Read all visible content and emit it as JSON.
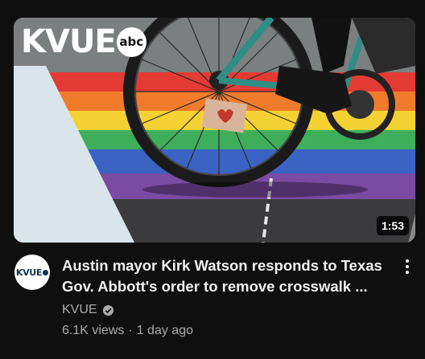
{
  "video": {
    "thumbnail": {
      "brand_text": "KVUE",
      "network_text": "abc",
      "duration": "1:53"
    },
    "channel_avatar_text": "KVUE",
    "title": "Austin mayor Kirk Watson responds to Texas Gov. Abbott's order to remove crosswalk ...",
    "channel": "KVUE",
    "views": "6.1K views",
    "separator": "·",
    "age": "1 day ago"
  },
  "icons": {
    "verified": "check-circle-icon",
    "more": "vertical-ellipsis-icon"
  },
  "colors": {
    "background": "#0f0f0f",
    "title": "#f1f1f1",
    "secondary_text": "#aaaaaa",
    "rainbow": [
      "#e33b34",
      "#f07c2b",
      "#f5d233",
      "#3fae5a",
      "#3a63c4",
      "#7b4aa3"
    ]
  }
}
